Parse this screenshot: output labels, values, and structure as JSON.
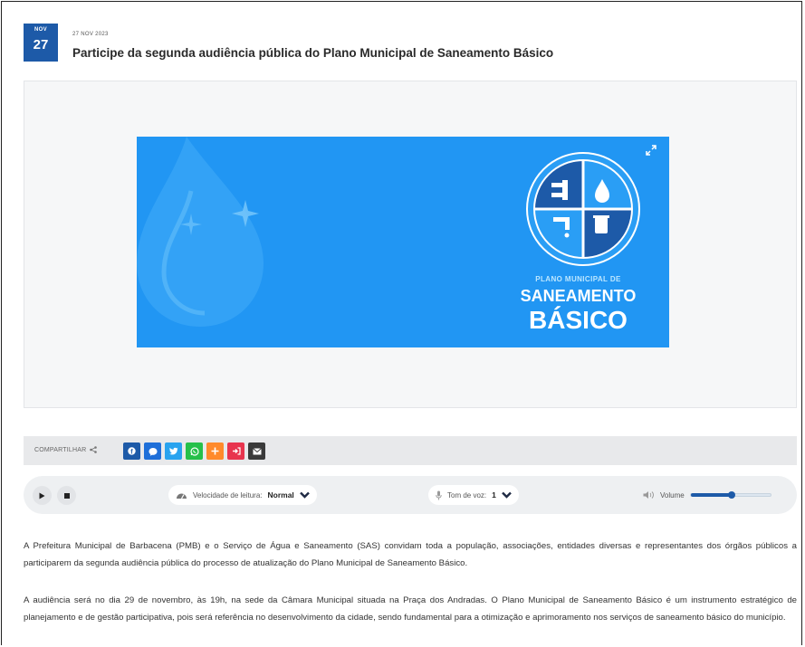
{
  "post": {
    "badge_month": "NOV",
    "badge_day": "27",
    "date": "27 NOV 2023",
    "title": "Participe da segunda audiência pública do Plano Municipal de Saneamento Básico"
  },
  "banner": {
    "line1": "PLANO MUNICIPAL DE",
    "line2": "SANEAMENTO",
    "line3": "BÁSICO",
    "colors": {
      "background": "#2196f3",
      "circle": "#1d5aa8",
      "accent": "#bde7ff"
    }
  },
  "share": {
    "label": "COMPARTILHAR",
    "buttons": [
      {
        "name": "facebook",
        "icon": "facebook-icon",
        "color": "#1d5aa8"
      },
      {
        "name": "messenger",
        "icon": "chat-bubble-icon",
        "color": "#1e6fd9"
      },
      {
        "name": "twitter",
        "icon": "twitter-icon",
        "color": "#29a3ef"
      },
      {
        "name": "whatsapp",
        "icon": "whatsapp-icon",
        "color": "#26c04a"
      },
      {
        "name": "more",
        "icon": "plus-icon",
        "color": "#ff8a2b"
      },
      {
        "name": "print",
        "icon": "print-icon",
        "color": "#e8344e"
      },
      {
        "name": "email",
        "icon": "envelope-icon",
        "color": "#3a3a3a"
      }
    ]
  },
  "player": {
    "speed_label": "Velocidade de leitura:",
    "speed_value": "Normal",
    "tone_label": "Tom de voz:",
    "tone_value": "1",
    "volume_label": "Volume",
    "volume_level": 0.5
  },
  "article": {
    "p1": "A Prefeitura Municipal de Barbacena (PMB) e o Serviço de Água e Saneamento (SAS) convidam toda a população, associações, entidades diversas e representantes dos órgãos públicos a participarem da segunda audiência pública do processo de atualização do Plano Municipal de Saneamento Básico.",
    "p2": "A audiência será no dia 29 de novembro, às 19h, na sede da Câmara Municipal situada na Praça dos Andradas. O Plano Municipal de Saneamento Básico é um instrumento estratégico de planejamento e de gestão participativa, pois será referência no desenvolvimento da cidade, sendo fundamental para a otimização e aprimoramento nos serviços de saneamento básico do município."
  }
}
